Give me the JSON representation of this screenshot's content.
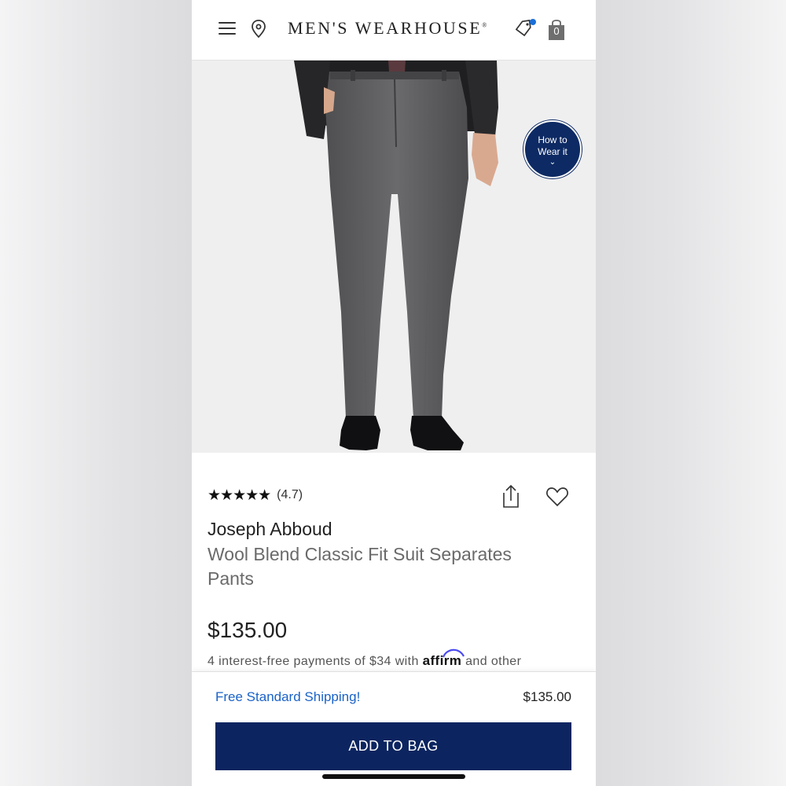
{
  "header": {
    "menu_icon": "hamburger-menu-icon",
    "location_icon": "map-pin-icon",
    "logo": "MEN'S WEARHOUSE",
    "logo_mark": "®",
    "deals_icon": "tag-icon",
    "bag_icon": "shopping-bag-icon",
    "bag_count": "0",
    "notification_color": "#1a6fd8"
  },
  "hero": {
    "how_to_wear_line1": "How to",
    "how_to_wear_line2": "Wear it",
    "how_to_wear_chevron": "⌄",
    "badge_color": "#0d2a64"
  },
  "product": {
    "stars": "★★★★★",
    "rating": 4.7,
    "rating_text": "(4.7)",
    "share_icon": "share-icon",
    "favorite_icon": "heart-icon",
    "brand": "Joseph Abboud",
    "name": "Wool Blend Classic Fit Suit Separates Pants",
    "price": "$135.00",
    "installments_prefix": "4 interest-free payments of $34 with ",
    "installments_provider": "affirm",
    "installments_suffix": " and other"
  },
  "bottom_bar": {
    "shipping_text": "Free Standard Shipping!",
    "price": "$135.00",
    "add_to_bag_label": "ADD TO BAG",
    "button_color": "#0c2560",
    "link_color": "#1a62c8"
  }
}
